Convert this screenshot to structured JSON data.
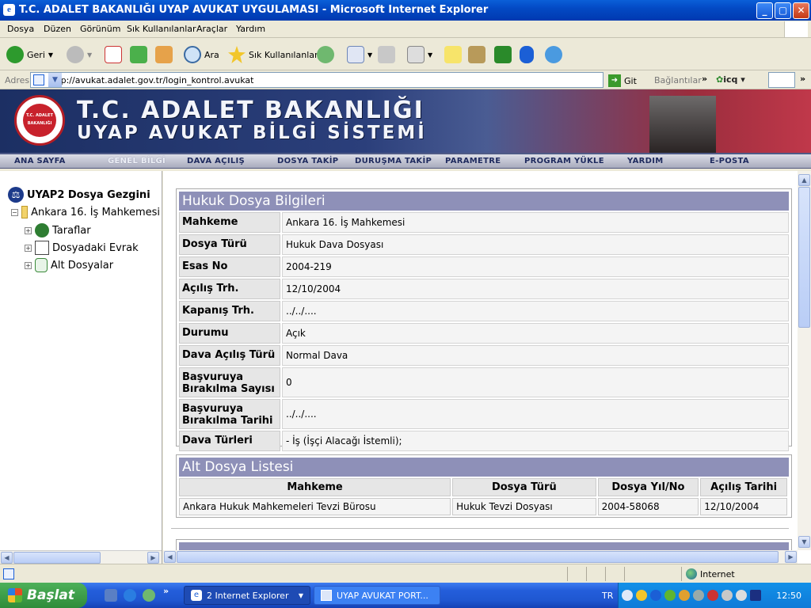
{
  "window": {
    "title": "T.C. ADALET BAKANLIĞI UYAP AVUKAT UYGULAMASI - Microsoft Internet Explorer",
    "min": "_",
    "max": "▢",
    "close": "✕"
  },
  "menu": [
    "Dosya",
    "Düzen",
    "Görünüm",
    "Sık Kullanılanlar",
    "Araçlar",
    "Yardım"
  ],
  "toolbar": {
    "back": "Geri",
    "search": "Ara",
    "favorites": "Sık Kullanılanlar"
  },
  "address": {
    "label": "Adres",
    "url": "http://avukat.adalet.gov.tr/login_kontrol.avukat",
    "go": "Git",
    "links": "Bağlantılar",
    "icq": "icq"
  },
  "banner": {
    "line1": "T.C. ADALET BAKANLIĞI",
    "line2": "UYAP AVUKAT BİLGİ SİSTEMİ",
    "seal": "T.C. ADALET BAKANLIĞI"
  },
  "nav": [
    "ANA SAYFA",
    "GENEL BİLGİ",
    "DAVA AÇILIŞ",
    "DOSYA TAKİP",
    "DURUŞMA TAKİP",
    "PARAMETRE",
    "PROGRAM YÜKLE",
    "YARDIM",
    "E-POSTA"
  ],
  "tree": {
    "root": "UYAP2 Dosya Gezgini",
    "court": "Ankara 16. İş Mahkemesi",
    "children": [
      "Taraflar",
      "Dosyadaki Evrak",
      "Alt Dosyalar"
    ]
  },
  "case": {
    "title": "Hukuk Dosya Bilgileri",
    "rows": [
      {
        "k": "Mahkeme",
        "v": "Ankara 16. İş Mahkemesi"
      },
      {
        "k": "Dosya Türü",
        "v": "Hukuk Dava Dosyası"
      },
      {
        "k": "Esas No",
        "v": "2004-219"
      },
      {
        "k": "Açılış Trh.",
        "v": "12/10/2004"
      },
      {
        "k": "Kapanış Trh.",
        "v": "../../...."
      },
      {
        "k": "Durumu",
        "v": "Açık"
      },
      {
        "k": "Dava Açılış Türü",
        "v": "Normal Dava"
      },
      {
        "k": "Başvuruya Bırakılma Sayısı",
        "v": "0"
      },
      {
        "k": "Başvuruya Bırakılma Tarihi",
        "v": "../../...."
      },
      {
        "k": "Dava Türleri",
        "v": "- İş (İşçi Alacağı İstemli);"
      }
    ]
  },
  "sub": {
    "title": "Alt Dosya Listesi",
    "headers": [
      "Mahkeme",
      "Dosya Türü",
      "Dosya Yıl/No",
      "Açılış Tarihi"
    ],
    "row": [
      "Ankara Hukuk Mahkemeleri Tevzi Bürosu",
      "Hukuk Tevzi Dosyası",
      "2004-58068",
      "12/10/2004"
    ]
  },
  "status": {
    "zone": "Internet"
  },
  "taskbar": {
    "start": "Başlat",
    "task1": "2 Internet Explorer",
    "task2": "UYAP AVUKAT PORT...",
    "lang": "TR",
    "clock": "12:50"
  }
}
